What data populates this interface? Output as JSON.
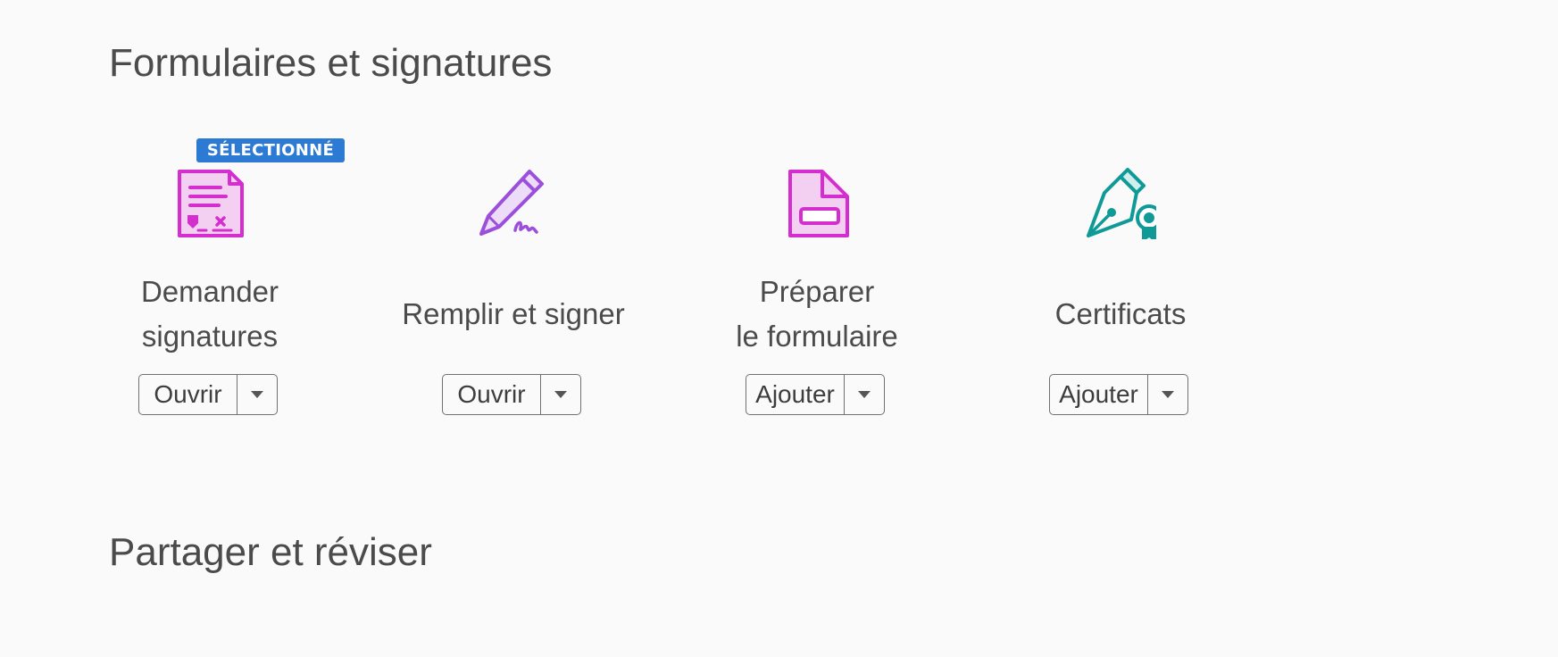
{
  "sections": {
    "forms_title": "Formulaires et signatures",
    "share_title": "Partager et réviser"
  },
  "badge": {
    "label": "SÉLECTIONNÉ",
    "color": "#2d7ad4"
  },
  "tools": [
    {
      "label_lines": [
        "Demander",
        "signatures"
      ],
      "icon": "request-signatures-icon",
      "button_label": "Ouvrir",
      "selected": true,
      "color": "#d42fce"
    },
    {
      "label_lines": [
        "Remplir et signer"
      ],
      "icon": "fill-sign-pen-icon",
      "button_label": "Ouvrir",
      "selected": false,
      "color": "#9b4fdb"
    },
    {
      "label_lines": [
        "Préparer",
        "le formulaire"
      ],
      "icon": "prepare-form-icon",
      "button_label": "Ajouter",
      "selected": false,
      "color": "#d42fce"
    },
    {
      "label_lines": [
        "Certificats"
      ],
      "icon": "certificate-pen-icon",
      "button_label": "Ajouter",
      "selected": false,
      "color": "#0f9a97"
    }
  ]
}
